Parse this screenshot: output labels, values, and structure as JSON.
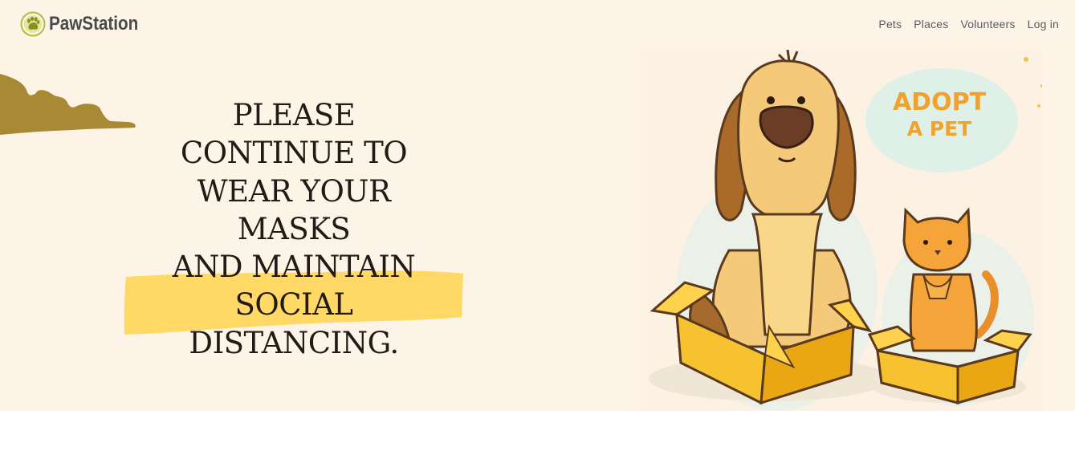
{
  "brand": {
    "name": "PawStation",
    "logo_icon": "paw-print-icon"
  },
  "nav": {
    "links": [
      "Pets",
      "Places",
      "Volunteers",
      "Log in"
    ]
  },
  "hero": {
    "headline_lines": [
      "PLEASE",
      "CONTINUE TO",
      "WEAR YOUR",
      "MASKS",
      "AND MAINTAIN",
      "SOCIAL",
      "DISTANCING."
    ],
    "illustration": {
      "line1": "ADOPT",
      "line2": "A PET",
      "subject": "dog-and-cat-in-boxes-illustration"
    }
  },
  "colors": {
    "background": "#fdf3e7",
    "highlight": "#ffd866",
    "brush": "#a88a35",
    "text": "#231a17",
    "logo": "#b3bc3c",
    "adopt_text": "#f0a22c"
  }
}
